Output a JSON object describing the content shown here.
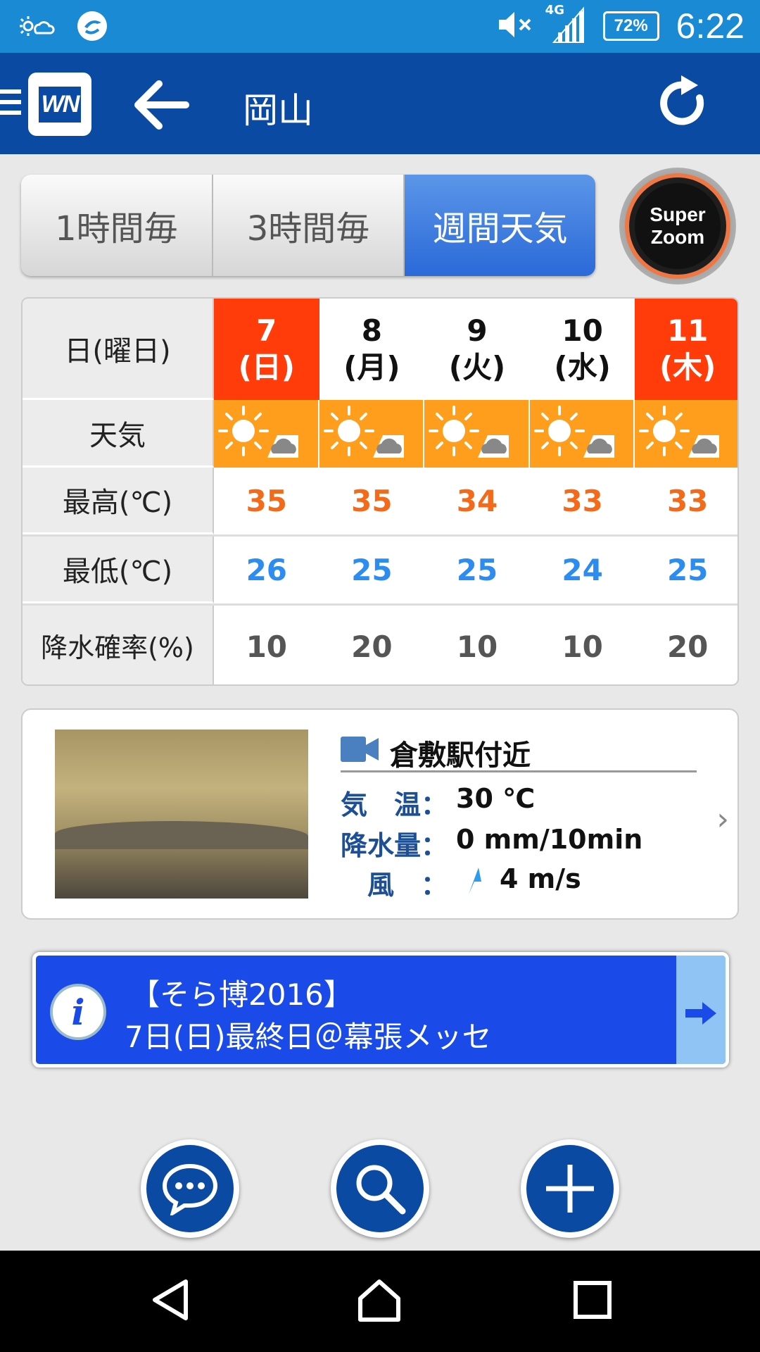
{
  "status_bar": {
    "time": "6:22",
    "battery": "72%",
    "network": "4G",
    "icons": [
      "weather-sun-cloud-icon",
      "app-notification-icon",
      "mute-icon",
      "signal-icon",
      "battery-icon"
    ]
  },
  "header": {
    "title": "岡山",
    "logo_text": "WN",
    "icons": [
      "menu-icon",
      "back-arrow-icon",
      "refresh-icon"
    ]
  },
  "tabs": [
    {
      "label": "1時間毎",
      "active": false
    },
    {
      "label": "3時間毎",
      "active": false
    },
    {
      "label": "週間天気",
      "active": true
    }
  ],
  "super_zoom": {
    "line1": "Super",
    "line2": "Zoom"
  },
  "table": {
    "row_labels": {
      "date": "日(曜日)",
      "weather": "天気",
      "high": "最高(℃)",
      "low": "最低(℃)",
      "rain": "降水確率(%)"
    },
    "days": [
      {
        "day": "7",
        "weekday": "(日)",
        "holiday": true,
        "weather": "sunny-then-cloudy",
        "high": "35",
        "low": "26",
        "rain": "10"
      },
      {
        "day": "8",
        "weekday": "(月)",
        "holiday": false,
        "weather": "sunny-then-cloudy",
        "high": "35",
        "low": "25",
        "rain": "20"
      },
      {
        "day": "9",
        "weekday": "(火)",
        "holiday": false,
        "weather": "sunny-then-cloudy",
        "high": "34",
        "low": "25",
        "rain": "10"
      },
      {
        "day": "10",
        "weekday": "(水)",
        "holiday": false,
        "weather": "sunny-then-cloudy",
        "high": "33",
        "low": "24",
        "rain": "10"
      },
      {
        "day": "11",
        "weekday": "(木)",
        "holiday": true,
        "weather": "sunny-then-cloudy",
        "high": "33",
        "low": "25",
        "rain": "20"
      }
    ]
  },
  "camera": {
    "location": "倉敷駅付近",
    "temp_label": "気　温：",
    "temp_value": "30 ℃",
    "precip_label": "降水量：",
    "precip_value": "0 mm/10min",
    "wind_label": "風　：",
    "wind_value": "4 m/s"
  },
  "banner": {
    "line1": "【そら博2016】",
    "line2": "7日(日)最終日＠幕張メッセ"
  },
  "actions": [
    "chat-icon",
    "search-icon",
    "add-icon"
  ],
  "colors": {
    "status_bar": "#1a8ad4",
    "header": "#0b4aa3",
    "holiday": "#ff3c0a",
    "high_temp": "#f26a1a",
    "low_temp": "#2d8cf0",
    "weather_bg": "#ff9d1c",
    "banner": "#1a4ae8"
  }
}
